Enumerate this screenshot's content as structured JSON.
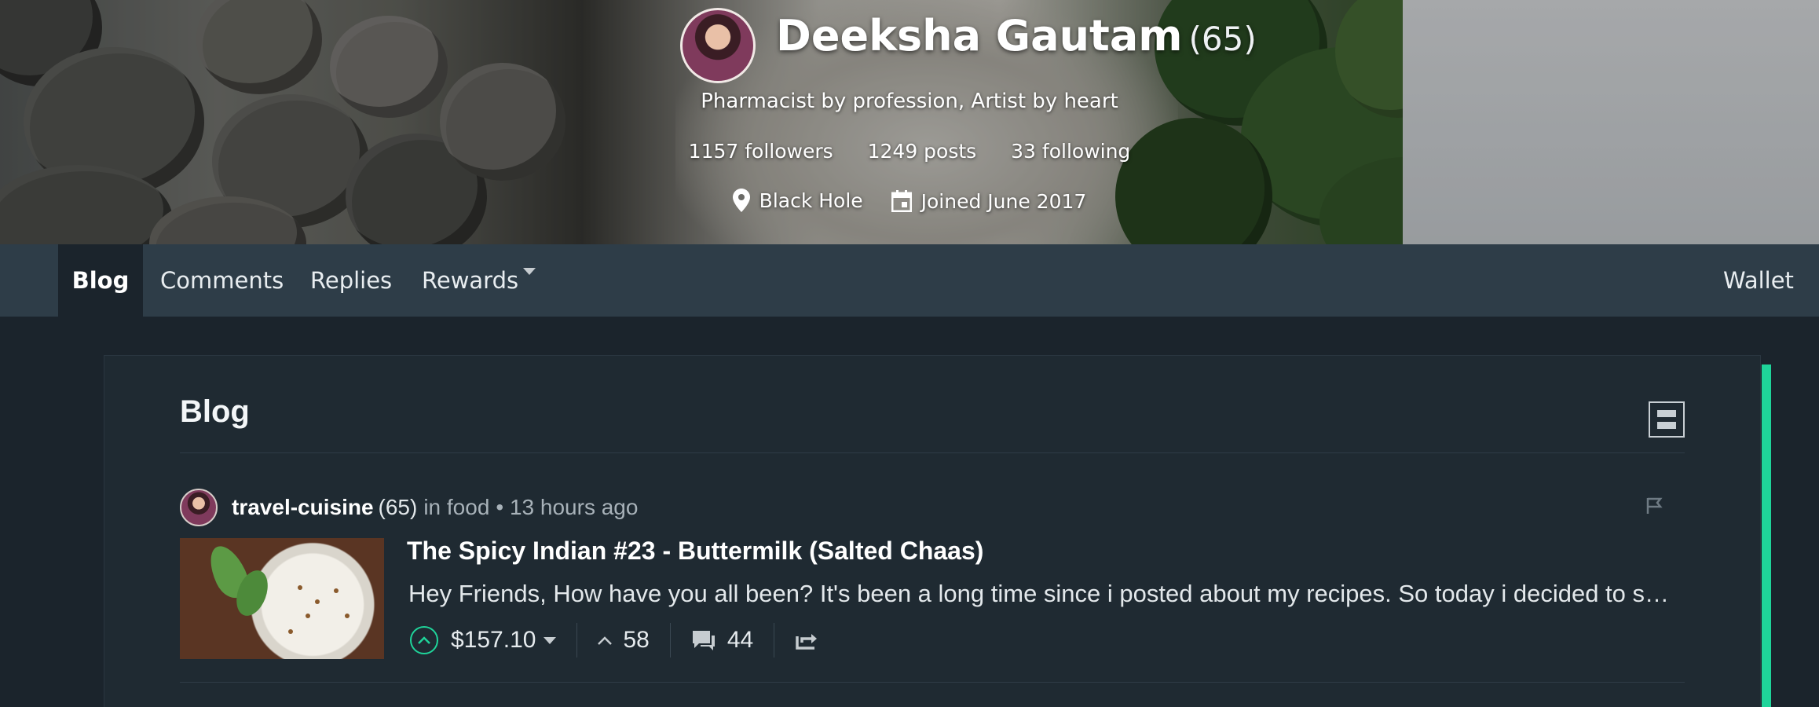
{
  "profile": {
    "name": "Deeksha Gautam",
    "reputation": "(65)",
    "about": "Pharmacist by profession, Artist by heart",
    "followers": "1157 followers",
    "posts": "1249 posts",
    "following": "33 following",
    "location": "Black Hole",
    "joined": "Joined June 2017"
  },
  "nav": {
    "tabs": [
      "Blog",
      "Comments",
      "Replies",
      "Rewards"
    ],
    "active": "Blog",
    "wallet": "Wallet"
  },
  "blog": {
    "title": "Blog",
    "post": {
      "author": "travel-cuisine",
      "author_reputation": "(65)",
      "category": "in food",
      "time": "• 13 hours ago",
      "title": "The Spicy Indian #23 - Buttermilk (Salted Chaas)",
      "body": "Hey Friends, How have you all been? It's been a long time since i posted about my recipes. So today i decided to share with you a recipe",
      "payout": "$157.10",
      "votes": "58",
      "comments": "44"
    }
  },
  "colors": {
    "accent": "#1fd49a",
    "nav_bg": "#2e3d48",
    "page_bg": "#1b242c"
  },
  "icons": [
    "location-pin-icon",
    "calendar-icon",
    "layout-toggle-icon",
    "flag-icon",
    "upvote-icon",
    "chevron-up-icon",
    "comments-icon",
    "reblog-icon"
  ]
}
